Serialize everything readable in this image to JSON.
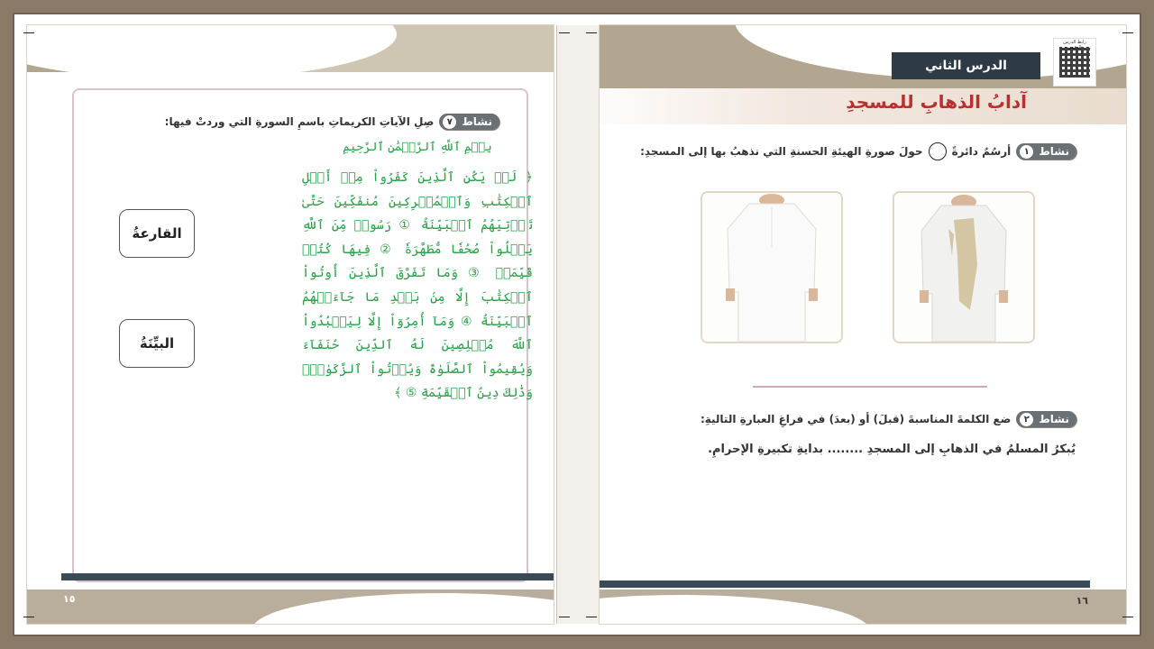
{
  "left_page": {
    "activity": {
      "label": "نشاط",
      "number": "٧",
      "instruction": "صِلِ الآياتِ الكريماتِ باسمِ السورةِ التي وردتْ فيها:"
    },
    "options": [
      "القارعةُ",
      "البيِّنَةُ"
    ],
    "basmala": "بِسۡمِ ٱللَّهِ ٱلرَّحۡمَٰنِ ٱلرَّحِيمِ",
    "quran_text": "﴿ لَمۡ يَكُنِ ٱلَّذِينَ كَفَرُواْ مِنۡ أَهۡلِ ٱلۡكِتَٰبِ وَٱلۡمُشۡرِكِينَ مُنفَكِّينَ حَتَّىٰ تَأۡتِيَهُمُ ٱلۡبَيِّنَةُ ① رَسُولٞ مِّنَ ٱللَّهِ يَتۡلُواْ صُحُفٗا مُّطَهَّرَةٗ ② فِيهَا كُتُبٞ قَيِّمَةٞ ③ وَمَا تَفَرَّقَ ٱلَّذِينَ أُوتُواْ ٱلۡكِتَٰبَ إِلَّا مِنۢ بَعۡدِ مَا جَآءَتۡهُمُ ٱلۡبَيِّنَةُ ④ وَمَآ أُمِرُوٓاْ إِلَّا لِيَعۡبُدُواْ ٱللَّهَ مُخۡلِصِينَ لَهُ ٱلدِّينَ حُنَفَآءَ وَيُقِيمُواْ ٱلصَّلَوٰةَ وَيُؤۡتُواْ ٱلزَّكَوٰةَۚ وَذَٰلِكَ دِينُ ٱلۡقَيِّمَةِ ⑤ ﴾",
    "page_number": "١٥"
  },
  "right_page": {
    "lesson": "الدرس الثاني",
    "title": "آدابُ الذهابِ للمسجدِ",
    "qr_caption": "رابط الدرس الرقمي",
    "activity1": {
      "label": "نشاط",
      "number": "١",
      "instruction_part1": "أرسُمُ دائرةً",
      "instruction_part2": "حولَ صورةِ الهيئةِ الحسنةِ التي نذهبُ بها إلى المسجدِ:"
    },
    "activity2": {
      "label": "نشاط",
      "number": "٢",
      "instruction": "ضع الكلمةَ المناسبةَ (قبلَ) أو (بعدَ) في فراغِ العبارةِ التاليةِ:"
    },
    "sentence": "يُبكرُ المسلمُ في الذهابِ إلى المسجدِ ........  بدايةِ تكبيرةِ الإحرامِ.",
    "page_number": "١٦"
  },
  "colors": {
    "accent_red": "#b8302f",
    "quran_green": "#2da04a",
    "dark_band": "#2e3a45",
    "tan": "#b3a690"
  }
}
